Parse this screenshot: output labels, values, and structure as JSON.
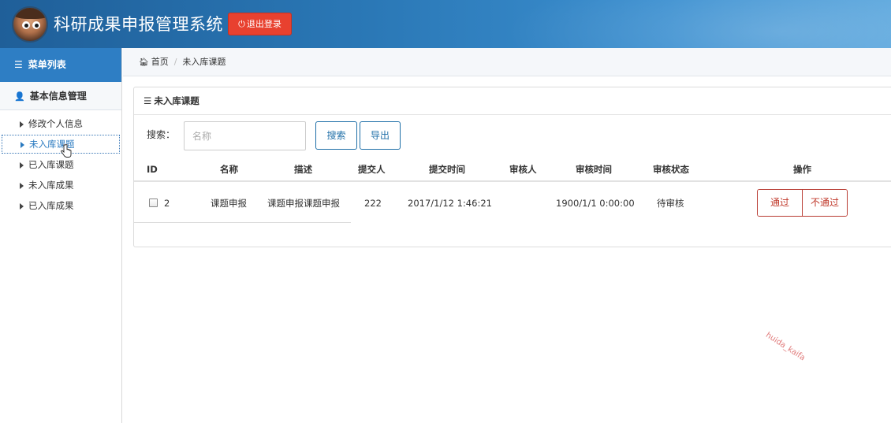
{
  "header": {
    "title": "科研成果申报管理系统",
    "logout_label": "退出登录",
    "logout_icon": "power-icon"
  },
  "sidebar": {
    "menu_title": "菜单列表",
    "group_title": "基本信息管理",
    "items": [
      {
        "label": "修改个人信息"
      },
      {
        "label": "未入库课题"
      },
      {
        "label": "已入库课题"
      },
      {
        "label": "未入库成果"
      },
      {
        "label": "已入库成果"
      }
    ],
    "active_index": 1
  },
  "breadcrumb": {
    "home": "首页",
    "current": "未入库课题"
  },
  "panel": {
    "title": "未入库课题",
    "search_label": "搜索：",
    "search_placeholder": "名称",
    "search_value": "",
    "search_button": "搜索",
    "export_button": "导出"
  },
  "table": {
    "columns": [
      "ID",
      "名称",
      "描述",
      "提交人",
      "提交时间",
      "审核人",
      "审核时间",
      "审核状态",
      "操作"
    ],
    "rows": [
      {
        "id": "2",
        "name": "课题申报",
        "desc": "课题申报课题申报",
        "submitter": "222",
        "submit_time": "2017/1/12 1:46:21",
        "reviewer": "",
        "review_time": "1900/1/1 0:00:00",
        "status": "待审核",
        "approve": "通过",
        "reject": "不通过"
      }
    ]
  },
  "watermark": "huida_kaifa",
  "colors": {
    "header_blue": "#2a77b5",
    "menu_blue": "#2e7ec4",
    "logout_red": "#e8412f",
    "action_red": "#c0392b",
    "button_blue": "#1f6fa8"
  }
}
